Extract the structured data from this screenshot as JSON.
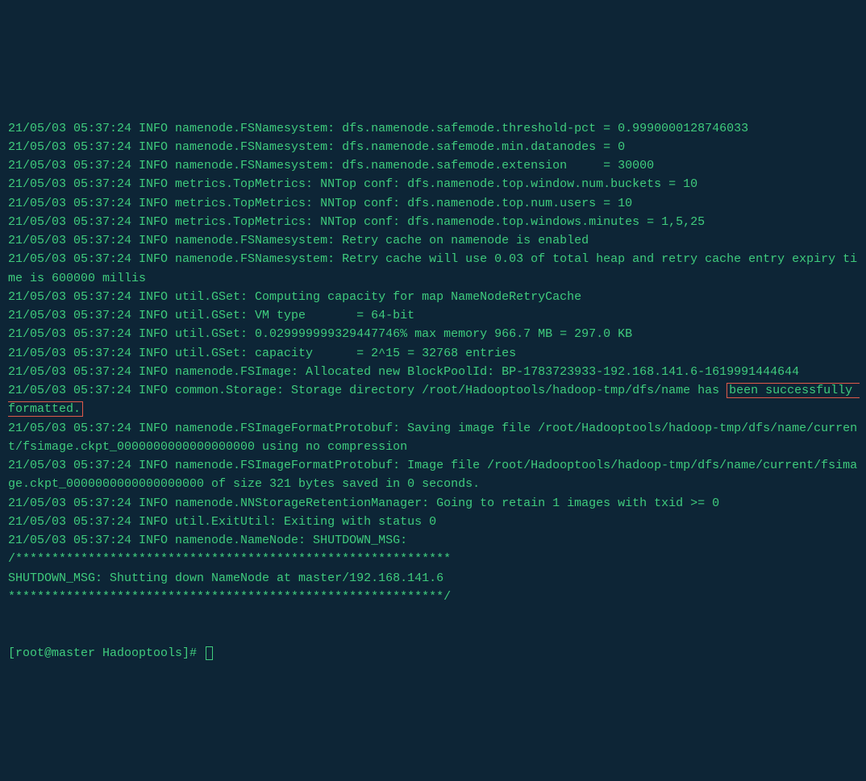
{
  "terminal": {
    "lines": [
      {
        "text": "21/05/03 05:37:24 INFO namenode.FSNamesystem: dfs.namenode.safemode.threshold-pct = 0.9990000128746033"
      },
      {
        "text": "21/05/03 05:37:24 INFO namenode.FSNamesystem: dfs.namenode.safemode.min.datanodes = 0"
      },
      {
        "text": "21/05/03 05:37:24 INFO namenode.FSNamesystem: dfs.namenode.safemode.extension     = 30000"
      },
      {
        "text": "21/05/03 05:37:24 INFO metrics.TopMetrics: NNTop conf: dfs.namenode.top.window.num.buckets = 10"
      },
      {
        "text": "21/05/03 05:37:24 INFO metrics.TopMetrics: NNTop conf: dfs.namenode.top.num.users = 10"
      },
      {
        "text": "21/05/03 05:37:24 INFO metrics.TopMetrics: NNTop conf: dfs.namenode.top.windows.minutes = 1,5,25"
      },
      {
        "text": "21/05/03 05:37:24 INFO namenode.FSNamesystem: Retry cache on namenode is enabled"
      },
      {
        "text": "21/05/03 05:37:24 INFO namenode.FSNamesystem: Retry cache will use 0.03 of total heap and retry cache entry expiry time is 600000 millis"
      },
      {
        "text": "21/05/03 05:37:24 INFO util.GSet: Computing capacity for map NameNodeRetryCache"
      },
      {
        "text": "21/05/03 05:37:24 INFO util.GSet: VM type       = 64-bit"
      },
      {
        "text": "21/05/03 05:37:24 INFO util.GSet: 0.029999999329447746% max memory 966.7 MB = 297.0 KB"
      },
      {
        "text": "21/05/03 05:37:24 INFO util.GSet: capacity      = 2^15 = 32768 entries"
      },
      {
        "text": "21/05/03 05:37:24 INFO namenode.FSImage: Allocated new BlockPoolId: BP-1783723933-192.168.141.6-1619991444644"
      },
      {
        "prefix": "21/05/03 05:37:24 INFO common.Storage: Storage directory /root/Hadooptools/hadoop-tmp/dfs/name has ",
        "highlight": "been successfully formatted."
      },
      {
        "text": "21/05/03 05:37:24 INFO namenode.FSImageFormatProtobuf: Saving image file /root/Hadooptools/hadoop-tmp/dfs/name/current/fsimage.ckpt_0000000000000000000 using no compression"
      },
      {
        "text": "21/05/03 05:37:24 INFO namenode.FSImageFormatProtobuf: Image file /root/Hadooptools/hadoop-tmp/dfs/name/current/fsimage.ckpt_0000000000000000000 of size 321 bytes saved in 0 seconds."
      },
      {
        "text": "21/05/03 05:37:24 INFO namenode.NNStorageRetentionManager: Going to retain 1 images with txid >= 0"
      },
      {
        "text": "21/05/03 05:37:24 INFO util.ExitUtil: Exiting with status 0"
      },
      {
        "text": "21/05/03 05:37:24 INFO namenode.NameNode: SHUTDOWN_MSG:"
      },
      {
        "text": "/************************************************************"
      },
      {
        "text": "SHUTDOWN_MSG: Shutting down NameNode at master/192.168.141.6"
      },
      {
        "text": "************************************************************/"
      }
    ],
    "prompt": "[root@master Hadooptools]# "
  }
}
